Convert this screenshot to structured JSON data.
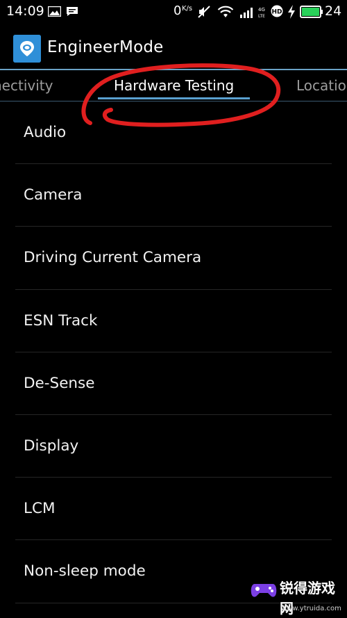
{
  "status_bar": {
    "time": "14:09",
    "net_speed": "0",
    "net_unit": "K/s",
    "lte": "4G LTE",
    "battery_level": "24",
    "colors": {
      "battery": "#29d25a"
    },
    "icons": [
      "image-icon",
      "message-icon",
      "mute-icon",
      "wifi-icon",
      "signal-icon",
      "lte-icon",
      "hd-icon",
      "charging-icon",
      "battery-icon"
    ]
  },
  "app": {
    "title": "EngineerMode",
    "icon_color": "#2f8fd8"
  },
  "tabs": [
    {
      "label": "nectivity",
      "active": false
    },
    {
      "label": "Hardware Testing",
      "active": true
    },
    {
      "label": "Locatio",
      "active": false
    }
  ],
  "list": {
    "items": [
      {
        "label": "Audio"
      },
      {
        "label": "Camera"
      },
      {
        "label": "Driving Current Camera"
      },
      {
        "label": "ESN Track"
      },
      {
        "label": "De-Sense"
      },
      {
        "label": "Display"
      },
      {
        "label": "LCM"
      },
      {
        "label": "Non-sleep mode"
      }
    ]
  },
  "annotation": {
    "color": "#e01f1f"
  },
  "watermark": {
    "text": "锐得游戏网",
    "url": "www.ytruida.com"
  }
}
